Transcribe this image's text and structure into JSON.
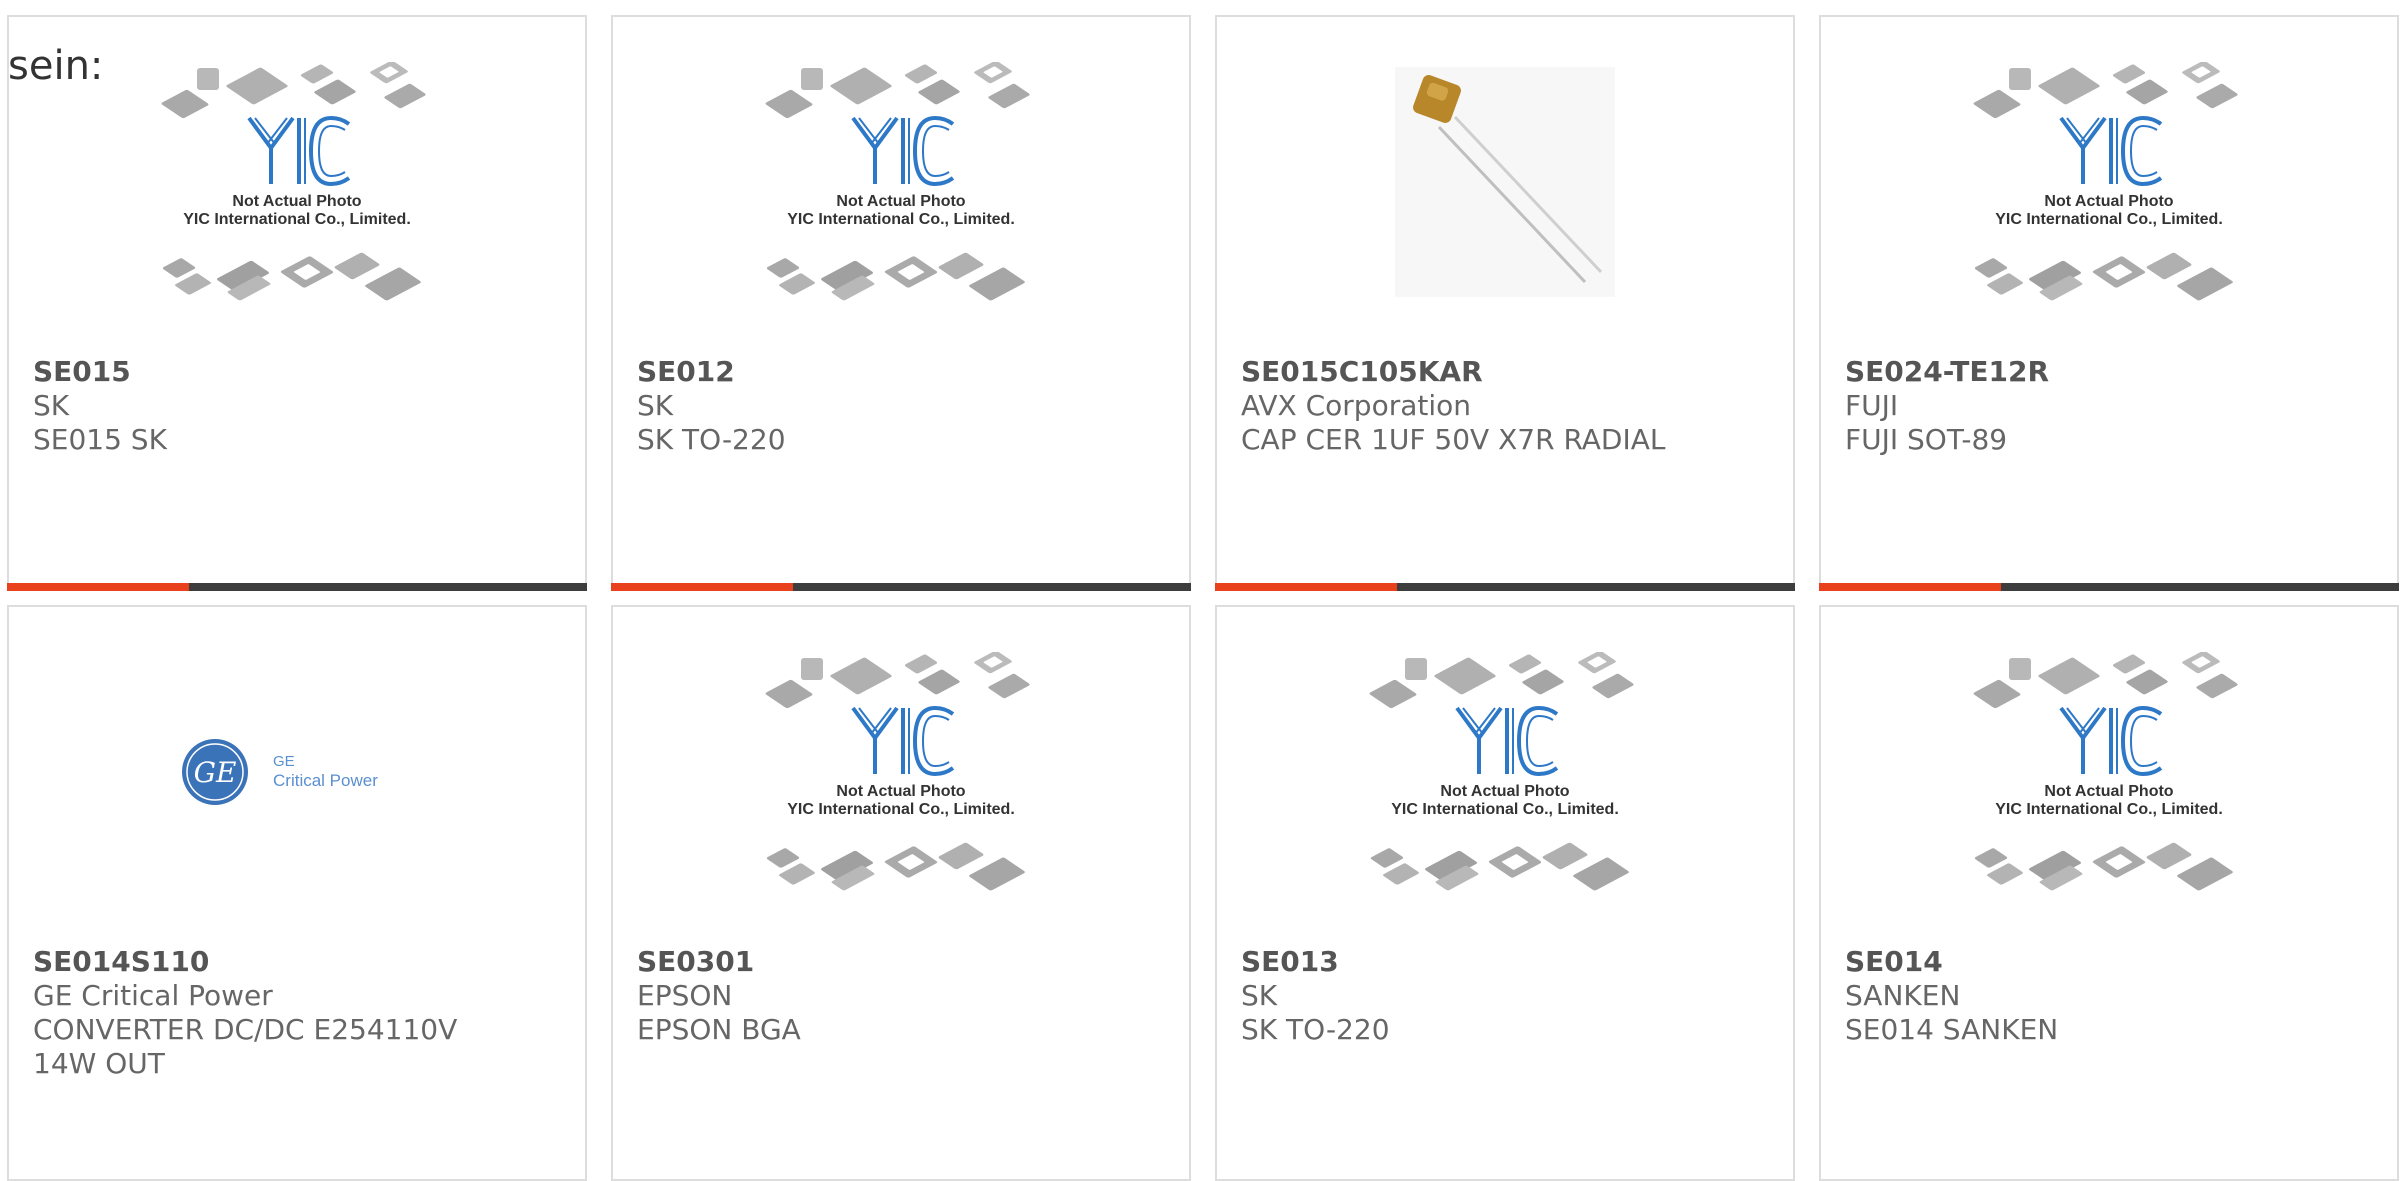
{
  "intro_text": "sein:",
  "placeholder": {
    "line1": "Not Actual Photo",
    "line2": "YIC International Co., Limited."
  },
  "ge_logo": {
    "line1": "GE",
    "line2": "Critical Power"
  },
  "colors": {
    "accent": "#e8411c",
    "bar": "#3d3d3d",
    "border": "#dddddd",
    "text": "#666666"
  },
  "products": [
    {
      "part": "SE015",
      "manufacturer": "SK",
      "description": "SE015 SK",
      "image": "placeholder"
    },
    {
      "part": "SE012",
      "manufacturer": "SK",
      "description": "SK TO-220",
      "image": "placeholder"
    },
    {
      "part": "SE015C105KAR",
      "manufacturer": "AVX Corporation",
      "description": "CAP CER 1UF 50V X7R RADIAL",
      "image": "capacitor"
    },
    {
      "part": "SE024-TE12R",
      "manufacturer": "FUJI",
      "description": "FUJI SOT-89",
      "image": "placeholder"
    },
    {
      "part": "SE014S110",
      "manufacturer": "GE Critical Power",
      "description": "CONVERTER DC/DC E254110V",
      "description2": "14W OUT",
      "image": "ge-logo"
    },
    {
      "part": "SE0301",
      "manufacturer": "EPSON",
      "description": "EPSON BGA",
      "image": "placeholder"
    },
    {
      "part": "SE013",
      "manufacturer": "SK",
      "description": "SK TO-220",
      "image": "placeholder"
    },
    {
      "part": "SE014",
      "manufacturer": "SANKEN",
      "description": "SE014 SANKEN",
      "image": "placeholder"
    }
  ]
}
